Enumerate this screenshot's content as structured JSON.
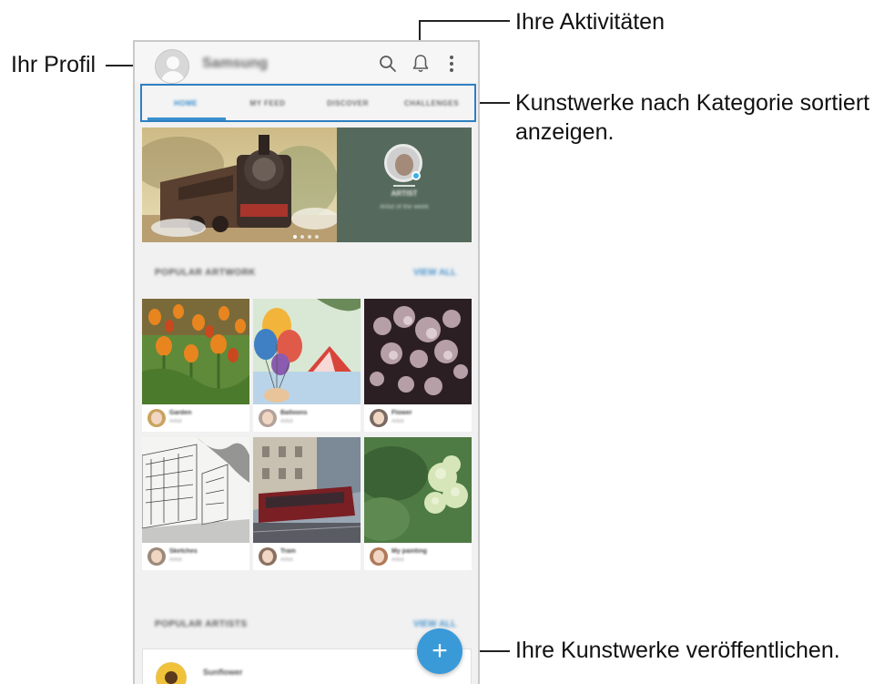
{
  "callouts": {
    "profile": "Ihr Profil",
    "activities": "Ihre Aktivitäten",
    "categories_line1": "Kunstwerke nach Kategorie sortiert",
    "categories_line2": "anzeigen.",
    "publish": "Ihre Kunstwerke veröffentlichen."
  },
  "app": {
    "name": "Samsung",
    "icons": [
      "search-icon",
      "bell-icon",
      "more-vert-icon"
    ]
  },
  "tabs": [
    {
      "label": "HOME",
      "active": true
    },
    {
      "label": "MY FEED",
      "active": false
    },
    {
      "label": "DISCOVER",
      "active": false
    },
    {
      "label": "CHALLENGES",
      "active": false
    }
  ],
  "banner": {
    "artist_name": "ARTIST",
    "subtitle": "Artist of the week"
  },
  "popular_artwork": {
    "heading": "POPULAR ARTWORK",
    "view_all": "VIEW ALL",
    "items": [
      {
        "title": "Garden",
        "by": "Artist"
      },
      {
        "title": "Balloons",
        "by": "Artist"
      },
      {
        "title": "Flower",
        "by": "Artist"
      },
      {
        "title": "Sketches",
        "by": "Artist"
      },
      {
        "title": "Tram",
        "by": "Artist"
      },
      {
        "title": "My painting",
        "by": "Artist"
      }
    ]
  },
  "popular_artists": {
    "heading": "POPULAR ARTISTS",
    "view_all": "VIEW ALL",
    "first_artist": "Sunflower"
  },
  "colors": {
    "accent": "#3a9ad8",
    "tab_highlight_border": "#2f7fc2",
    "banner_panel": "#556a5c"
  }
}
